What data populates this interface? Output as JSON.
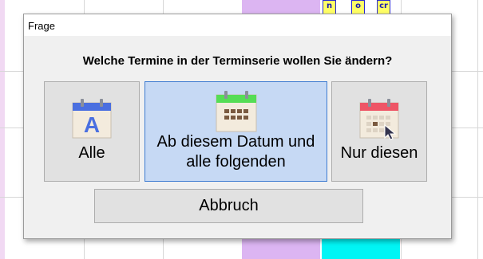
{
  "dialog": {
    "title": "Frage",
    "question": "Welche Termine in der Terminserie wollen Sie ändern?",
    "options": [
      {
        "label": "Alle",
        "icon": "calendar-a-icon",
        "accent": "#4a6fe0"
      },
      {
        "label_line1": "Ab diesem Datum und",
        "label_line2": "alle folgenden",
        "icon": "calendar-grid-icon",
        "accent": "#55dd55",
        "selected": true
      },
      {
        "label": "Nur diesen",
        "icon": "calendar-cursor-icon",
        "accent": "#ee5566"
      }
    ],
    "cancel_label": "Abbruch"
  },
  "background": {
    "appointments": [
      "n",
      "o",
      "cr"
    ]
  },
  "colors": {
    "selected_bg": "#c6d9f4",
    "selected_border": "#3d7bd1",
    "purple_column": "#dcb5f2",
    "cyan_column": "#00f5f5"
  }
}
